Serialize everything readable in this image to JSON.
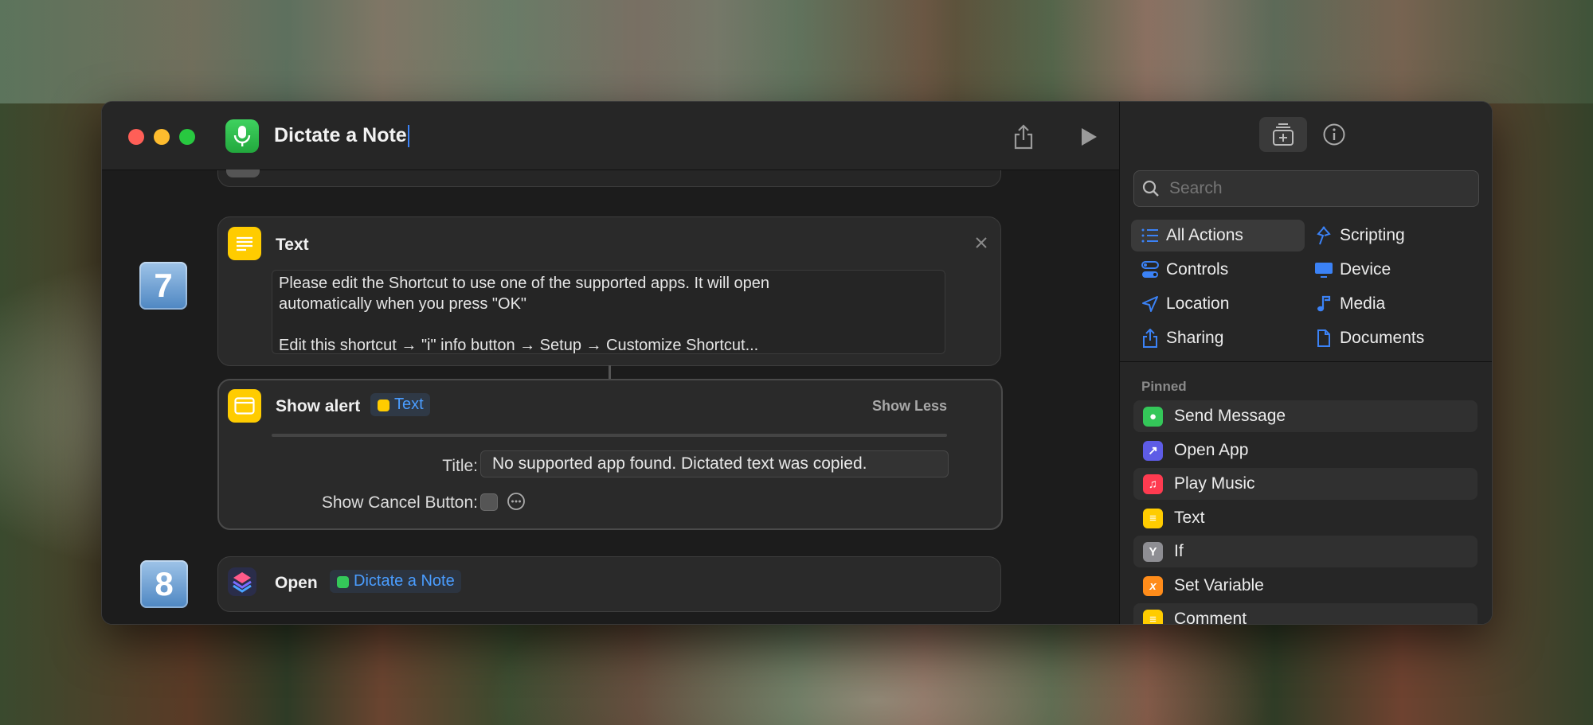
{
  "window": {
    "title": "Dictate a Note"
  },
  "steps": [
    {
      "number": "7"
    },
    {
      "number": "8"
    }
  ],
  "text_action": {
    "title": "Text",
    "line1": "Please edit the Shortcut to use one of the supported apps. It will open",
    "line2": "automatically when you press \"OK\"",
    "line3": "Edit this shortcut → \"i\" info button → Setup → Customize Shortcut..."
  },
  "alert_action": {
    "title": "Show alert",
    "token": "Text",
    "show_less": "Show Less",
    "title_label": "Title:",
    "title_value": "No supported app found. Dictated text was copied.",
    "cancel_label": "Show Cancel Button:"
  },
  "open_action": {
    "title": "Open",
    "token": "Dictate a Note"
  },
  "sidebar": {
    "search_placeholder": "Search",
    "categories": [
      {
        "label": "All Actions",
        "icon": "list-icon"
      },
      {
        "label": "Scripting",
        "icon": "scripting-icon"
      },
      {
        "label": "Controls",
        "icon": "toggles-icon"
      },
      {
        "label": "Device",
        "icon": "display-icon"
      },
      {
        "label": "Location",
        "icon": "location-arrow-icon"
      },
      {
        "label": "Media",
        "icon": "music-note-icon"
      },
      {
        "label": "Sharing",
        "icon": "share-icon"
      },
      {
        "label": "Documents",
        "icon": "document-icon"
      }
    ],
    "pinned_header": "Pinned",
    "pinned": [
      {
        "label": "Send Message",
        "icon": "message-icon",
        "color": "#34c759"
      },
      {
        "label": "Open App",
        "icon": "arrow-up-right-icon",
        "color": "#5e5ce6"
      },
      {
        "label": "Play Music",
        "icon": "music-note-icon",
        "color": "#ff3b50"
      },
      {
        "label": "Text",
        "icon": "text-lines-icon",
        "color": "#ffcc00"
      },
      {
        "label": "If",
        "icon": "branch-icon",
        "color": "#8e8e93"
      },
      {
        "label": "Set Variable",
        "icon": "variable-x-icon",
        "color": "#ff8c1a"
      },
      {
        "label": "Comment",
        "icon": "comment-lines-icon",
        "color": "#ffcc00"
      }
    ]
  },
  "colors": {
    "accent": "#3b82f6",
    "token_text": "#4a9dff"
  }
}
